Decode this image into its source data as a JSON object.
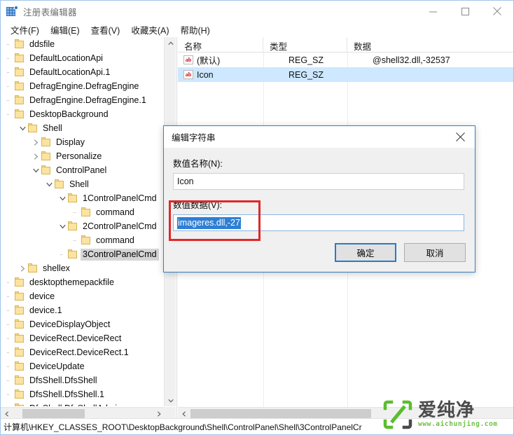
{
  "window": {
    "title": "注册表编辑器",
    "icon": "registry-icon",
    "minimize_label": "最小化",
    "maximize_label": "最大化",
    "close_label": "关闭"
  },
  "menubar": {
    "items": [
      {
        "label": "文件(F)"
      },
      {
        "label": "编辑(E)"
      },
      {
        "label": "查看(V)"
      },
      {
        "label": "收藏夹(A)"
      },
      {
        "label": "帮助(H)"
      }
    ]
  },
  "tree": {
    "items": [
      {
        "label": "ddsfile",
        "indent": 0,
        "twisty": "none",
        "selected": false
      },
      {
        "label": "DefaultLocationApi",
        "indent": 0,
        "twisty": "none",
        "selected": false
      },
      {
        "label": "DefaultLocationApi.1",
        "indent": 0,
        "twisty": "none",
        "selected": false
      },
      {
        "label": "DefragEngine.DefragEngine",
        "indent": 0,
        "twisty": "none",
        "selected": false
      },
      {
        "label": "DefragEngine.DefragEngine.1",
        "indent": 0,
        "twisty": "none",
        "selected": false
      },
      {
        "label": "DesktopBackground",
        "indent": 0,
        "twisty": "none",
        "selected": false
      },
      {
        "label": "Shell",
        "indent": 1,
        "twisty": "expanded",
        "selected": false
      },
      {
        "label": "Display",
        "indent": 2,
        "twisty": "collapsed",
        "selected": false
      },
      {
        "label": "Personalize",
        "indent": 2,
        "twisty": "collapsed",
        "selected": false
      },
      {
        "label": "ControlPanel",
        "indent": 2,
        "twisty": "expanded",
        "selected": false
      },
      {
        "label": "Shell",
        "indent": 3,
        "twisty": "expanded",
        "selected": false
      },
      {
        "label": "1ControlPanelCmd",
        "indent": 4,
        "twisty": "expanded",
        "selected": false
      },
      {
        "label": "command",
        "indent": 5,
        "twisty": "none",
        "selected": false
      },
      {
        "label": "2ControlPanelCmd",
        "indent": 4,
        "twisty": "expanded",
        "selected": false
      },
      {
        "label": "command",
        "indent": 5,
        "twisty": "none",
        "selected": false
      },
      {
        "label": "3ControlPanelCmd",
        "indent": 4,
        "twisty": "none",
        "selected": true
      },
      {
        "label": "shellex",
        "indent": 1,
        "twisty": "collapsed",
        "selected": false
      },
      {
        "label": "desktopthemepackfile",
        "indent": 0,
        "twisty": "none",
        "selected": false
      },
      {
        "label": "device",
        "indent": 0,
        "twisty": "none",
        "selected": false
      },
      {
        "label": "device.1",
        "indent": 0,
        "twisty": "none",
        "selected": false
      },
      {
        "label": "DeviceDisplayObject",
        "indent": 0,
        "twisty": "none",
        "selected": false
      },
      {
        "label": "DeviceRect.DeviceRect",
        "indent": 0,
        "twisty": "none",
        "selected": false
      },
      {
        "label": "DeviceRect.DeviceRect.1",
        "indent": 0,
        "twisty": "none",
        "selected": false
      },
      {
        "label": "DeviceUpdate",
        "indent": 0,
        "twisty": "none",
        "selected": false
      },
      {
        "label": "DfsShell.DfsShell",
        "indent": 0,
        "twisty": "none",
        "selected": false
      },
      {
        "label": "DfsShell.DfsShell.1",
        "indent": 0,
        "twisty": "none",
        "selected": false
      },
      {
        "label": "DfsShell.DfsShellAdmin",
        "indent": 0,
        "twisty": "none",
        "selected": false
      }
    ]
  },
  "list": {
    "columns": [
      "名称",
      "类型",
      "数据"
    ],
    "rows": [
      {
        "name": "(默认)",
        "type": "REG_SZ",
        "data": "@shell32.dll,-32537",
        "selected": false
      },
      {
        "name": "Icon",
        "type": "REG_SZ",
        "data": "",
        "selected": true
      }
    ]
  },
  "statusbar": {
    "path": "计算机\\HKEY_CLASSES_ROOT\\DesktopBackground\\Shell\\ControlPanel\\Shell\\3ControlPanelCr"
  },
  "dialog": {
    "title": "编辑字符串",
    "name_label": "数值名称(N):",
    "name_value": "Icon",
    "data_label": "数值数据(V):",
    "data_value": "imageres.dll,-27",
    "ok_label": "确定",
    "cancel_label": "取消",
    "close_label": "关闭",
    "highlight_color": "#e02828",
    "selection_color": "#2e7fd4"
  },
  "watermark": {
    "brand": "爱纯净",
    "url": "www.aichunjing.com",
    "accent": "#6fbe44"
  }
}
